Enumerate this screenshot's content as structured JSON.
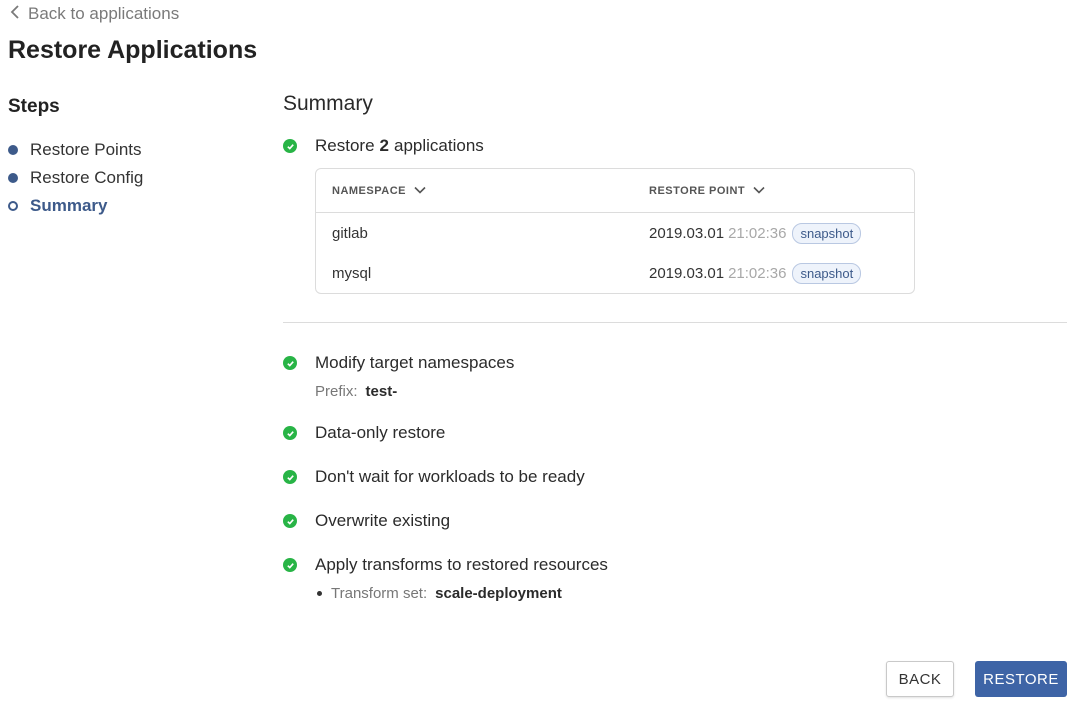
{
  "nav": {
    "back_label": "Back to applications"
  },
  "page": {
    "title": "Restore Applications"
  },
  "steps": {
    "title": "Steps",
    "items": [
      {
        "label": "Restore Points",
        "state": "done"
      },
      {
        "label": "Restore Config",
        "state": "done"
      },
      {
        "label": "Summary",
        "state": "current"
      }
    ]
  },
  "summary": {
    "title": "Summary",
    "restore_prefix": "Restore",
    "restore_count": "2",
    "restore_suffix": "applications",
    "table": {
      "columns": [
        "NAMESPACE",
        "RESTORE POINT"
      ],
      "rows": [
        {
          "namespace": "gitlab",
          "date": "2019.03.01",
          "time": "21:02:36",
          "tag": "snapshot"
        },
        {
          "namespace": "mysql",
          "date": "2019.03.01",
          "time": "21:02:36",
          "tag": "snapshot"
        }
      ]
    },
    "options": [
      {
        "label": "Modify target namespaces",
        "detail_label": "Prefix:",
        "detail_value": "test-"
      },
      {
        "label": "Data-only restore"
      },
      {
        "label": "Don't wait for workloads to be ready"
      },
      {
        "label": "Overwrite existing"
      },
      {
        "label": "Apply transforms to restored resources",
        "detail_label": "Transform set:",
        "detail_value": "scale-deployment"
      }
    ]
  },
  "actions": {
    "back_label": "BACK",
    "restore_label": "RESTORE"
  },
  "colors": {
    "accent": "#3e64a6",
    "success": "#28b446",
    "step": "#3d5a8a"
  }
}
